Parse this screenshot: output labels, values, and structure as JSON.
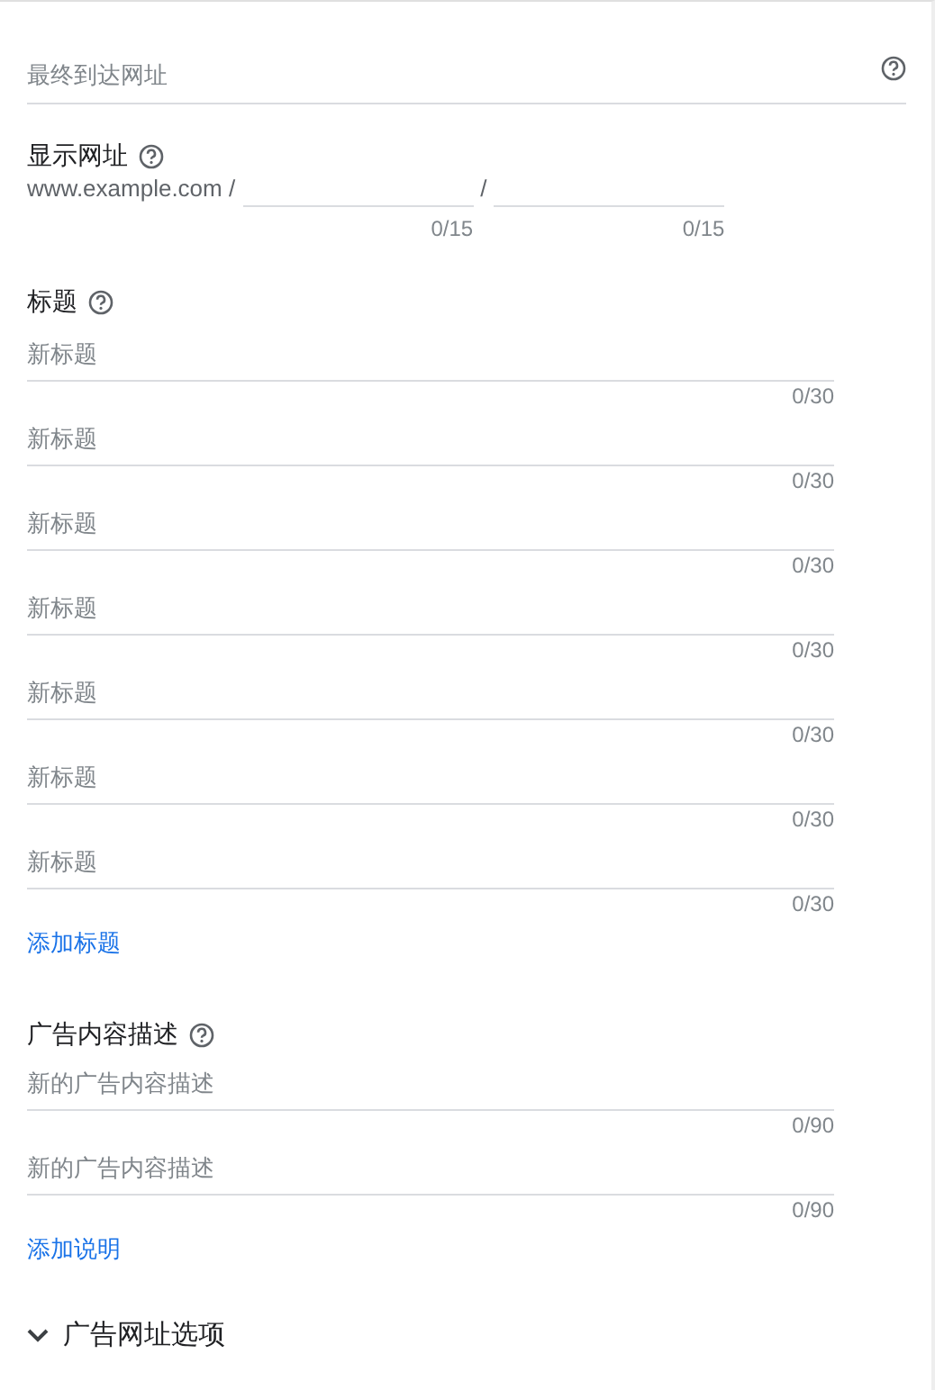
{
  "final_url": {
    "placeholder": "最终到达网址"
  },
  "display_url": {
    "label": "显示网址",
    "domain": "www.example.com /",
    "separator": "/",
    "paths": [
      {
        "counter": "0/15"
      },
      {
        "counter": "0/15"
      }
    ]
  },
  "headlines": {
    "label": "标题",
    "fields": [
      {
        "placeholder": "新标题",
        "counter": "0/30"
      },
      {
        "placeholder": "新标题",
        "counter": "0/30"
      },
      {
        "placeholder": "新标题",
        "counter": "0/30"
      },
      {
        "placeholder": "新标题",
        "counter": "0/30"
      },
      {
        "placeholder": "新标题",
        "counter": "0/30"
      },
      {
        "placeholder": "新标题",
        "counter": "0/30"
      },
      {
        "placeholder": "新标题",
        "counter": "0/30"
      }
    ],
    "add_link": "添加标题"
  },
  "descriptions": {
    "label": "广告内容描述",
    "fields": [
      {
        "placeholder": "新的广告内容描述",
        "counter": "0/90"
      },
      {
        "placeholder": "新的广告内容描述",
        "counter": "0/90"
      }
    ],
    "add_link": "添加说明"
  },
  "url_options": {
    "label": "广告网址选项",
    "expanded": false
  }
}
